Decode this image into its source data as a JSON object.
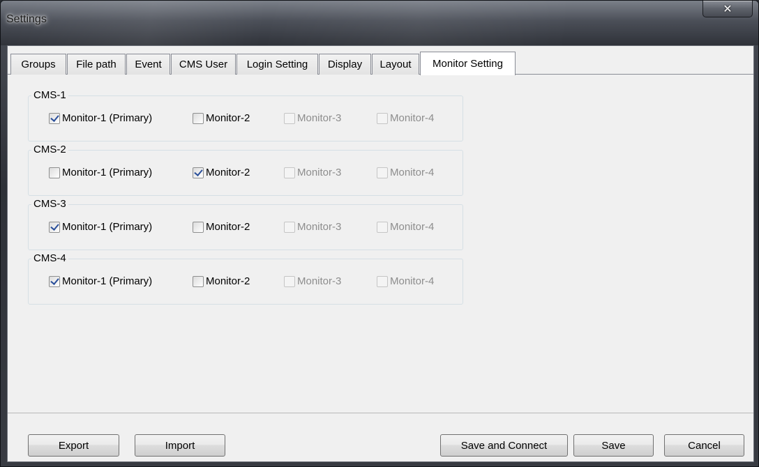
{
  "window": {
    "title": "Settings",
    "close_icon": "close-icon"
  },
  "tabs": [
    {
      "label": "Groups",
      "active": false
    },
    {
      "label": "File path",
      "active": false
    },
    {
      "label": "Event",
      "active": false
    },
    {
      "label": "CMS User",
      "active": false
    },
    {
      "label": "Login Setting",
      "active": false
    },
    {
      "label": "Display",
      "active": false
    },
    {
      "label": "Layout",
      "active": false
    },
    {
      "label": "Monitor Setting",
      "active": true
    }
  ],
  "groups": [
    {
      "label": "CMS-1",
      "monitors": [
        {
          "label": "Monitor-1 (Primary)",
          "checked": true,
          "enabled": true
        },
        {
          "label": "Monitor-2",
          "checked": false,
          "enabled": true
        },
        {
          "label": "Monitor-3",
          "checked": false,
          "enabled": false
        },
        {
          "label": "Monitor-4",
          "checked": false,
          "enabled": false
        }
      ]
    },
    {
      "label": "CMS-2",
      "monitors": [
        {
          "label": "Monitor-1 (Primary)",
          "checked": false,
          "enabled": true
        },
        {
          "label": "Monitor-2",
          "checked": true,
          "enabled": true
        },
        {
          "label": "Monitor-3",
          "checked": false,
          "enabled": false
        },
        {
          "label": "Monitor-4",
          "checked": false,
          "enabled": false
        }
      ]
    },
    {
      "label": "CMS-3",
      "monitors": [
        {
          "label": "Monitor-1 (Primary)",
          "checked": true,
          "enabled": true
        },
        {
          "label": "Monitor-2",
          "checked": false,
          "enabled": true
        },
        {
          "label": "Monitor-3",
          "checked": false,
          "enabled": false
        },
        {
          "label": "Monitor-4",
          "checked": false,
          "enabled": false
        }
      ]
    },
    {
      "label": "CMS-4",
      "monitors": [
        {
          "label": "Monitor-1 (Primary)",
          "checked": true,
          "enabled": true
        },
        {
          "label": "Monitor-2",
          "checked": false,
          "enabled": true
        },
        {
          "label": "Monitor-3",
          "checked": false,
          "enabled": false
        },
        {
          "label": "Monitor-4",
          "checked": false,
          "enabled": false
        }
      ]
    }
  ],
  "buttons": {
    "export": "Export",
    "import": "Import",
    "save_connect": "Save and Connect",
    "save": "Save",
    "cancel": "Cancel"
  }
}
